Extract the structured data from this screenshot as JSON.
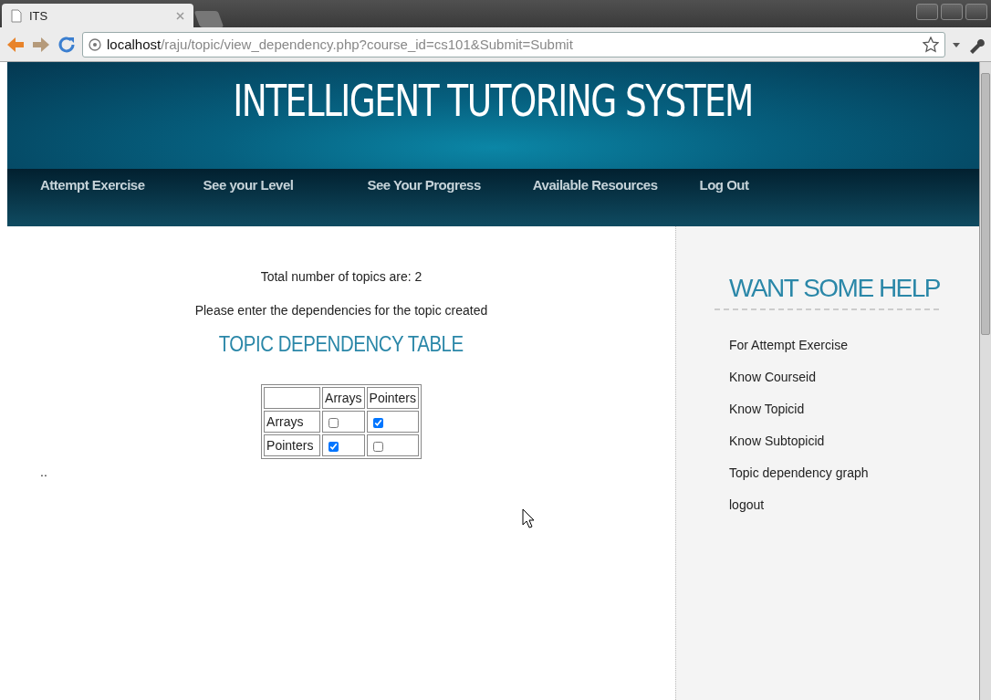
{
  "browser": {
    "tab_title": "ITS",
    "url_host": "localhost",
    "url_path": "/raju/topic/view_dependency.php?course_id=cs101&Submit=Submit"
  },
  "header": {
    "title": "INTELLIGENT TUTORING SYSTEM"
  },
  "nav": [
    "Attempt Exercise",
    "See your Level",
    "See Your Progress",
    "Available Resources",
    "Log Out"
  ],
  "main": {
    "topic_count": "Total number of topics are: 2",
    "instruction": "Please enter the dependencies for the topic created",
    "heading": "TOPIC DEPENDENCY TABLE",
    "table": {
      "columns": [
        "Arrays",
        "Pointers"
      ],
      "rows": [
        {
          "label": "Arrays",
          "checked": [
            false,
            true
          ]
        },
        {
          "label": "Pointers",
          "checked": [
            true,
            false
          ]
        }
      ]
    },
    "footer_text": ".."
  },
  "sidebar": {
    "heading": "WANT SOME HELP",
    "items": [
      "For Attempt Exercise",
      "Know Courseid",
      "Know Topicid",
      "Know Subtopicid",
      "Topic dependency graph",
      "logout"
    ]
  }
}
